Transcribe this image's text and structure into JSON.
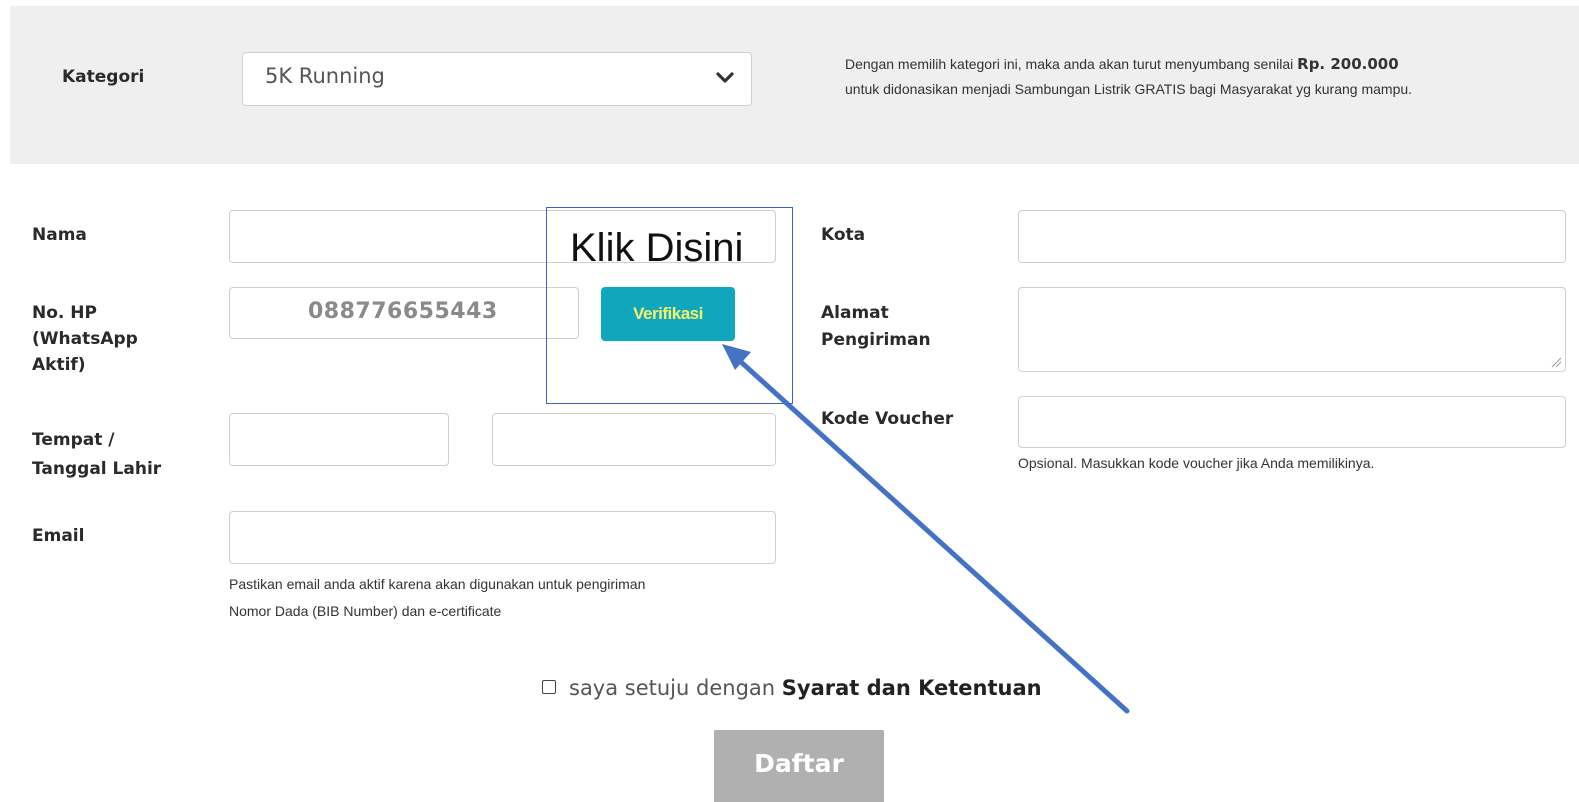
{
  "category": {
    "label": "Kategori",
    "selected": "5K Running",
    "note_part1": "Dengan memilih kategori ini, maka anda akan turut menyumbang senilai ",
    "note_amount": "Rp. 200.000",
    "note_part2": "untuk didonasikan menjadi Sambungan Listrik GRATIS bagi Masyarakat yg kurang mampu."
  },
  "form": {
    "name_label": "Nama",
    "name_value": "",
    "phone_label_line1": "No. HP",
    "phone_label_line2": "(WhatsApp",
    "phone_label_line3": "Aktif)",
    "phone_value": "088776655443",
    "verify_label": "Verifikasi",
    "birth_label_line1": "Tempat /",
    "birth_label_line2": "Tanggal Lahir",
    "birth_place_value": "",
    "birth_date_value": "",
    "email_label": "Email",
    "email_value": "",
    "email_help_line1": "Pastikan email anda aktif karena akan digunakan untuk pengiriman",
    "email_help_line2": "Nomor Dada (BIB Number) dan e-certificate",
    "city_label": "Kota",
    "city_value": "",
    "address_label_line1": "Alamat",
    "address_label_line2": "Pengiriman",
    "address_value": "",
    "voucher_label": "Kode Voucher",
    "voucher_value": "",
    "voucher_help": "Opsional. Masukkan kode voucher jika Anda memilikinya."
  },
  "agreement": {
    "text": "saya setuju dengan ",
    "link": "Syarat dan Ketentuan",
    "checked": false
  },
  "submit": {
    "label": "Daftar"
  },
  "annotation": {
    "text": "Klik Disini",
    "color": "#4472c4"
  },
  "colors": {
    "verify_button": "#10a7bd",
    "verify_text": "#f2f26a",
    "submit_disabled": "#b0b0b0",
    "panel_bg": "#efefef"
  }
}
